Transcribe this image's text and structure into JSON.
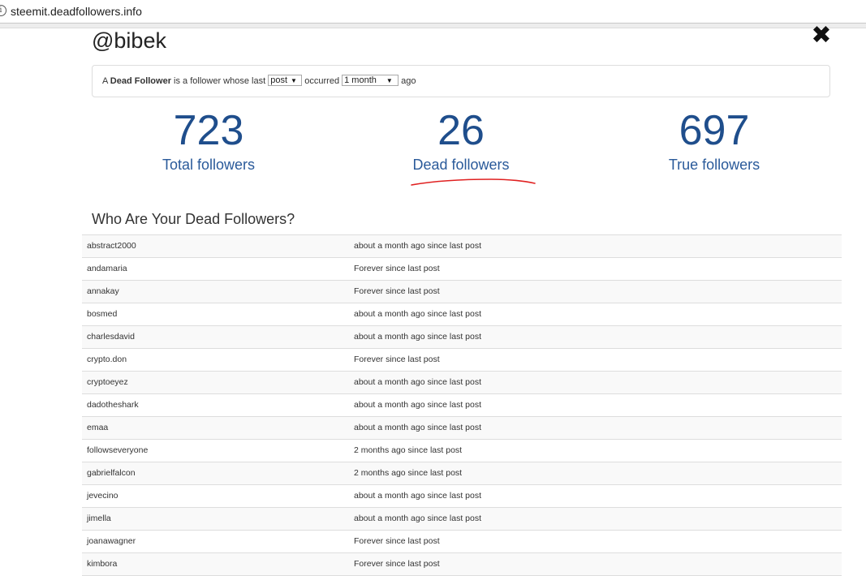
{
  "browser": {
    "url": "steemit.deadfollowers.info",
    "info_icon": "info-icon"
  },
  "modal": {
    "handle": "@bibek",
    "close_icon": "close-x-icon",
    "close_glyph": "✖"
  },
  "definition": {
    "prefix": "A ",
    "term": "Dead Follower",
    "middle1": " is a follower whose last ",
    "activity_select": "post",
    "middle2": " occurred ",
    "period_select": "1 month",
    "suffix": " ago"
  },
  "stats": {
    "total": {
      "value": "723",
      "label": "Total followers"
    },
    "dead": {
      "value": "26",
      "label": "Dead followers"
    },
    "true": {
      "value": "697",
      "label": "True followers"
    }
  },
  "list": {
    "heading": "Who Are Your Dead Followers?",
    "rows": [
      {
        "name": "abstract2000",
        "status": "about a month ago since last post"
      },
      {
        "name": "andamaria",
        "status": "Forever since last post"
      },
      {
        "name": "annakay",
        "status": "Forever since last post"
      },
      {
        "name": "bosmed",
        "status": "about a month ago since last post"
      },
      {
        "name": "charlesdavid",
        "status": "about a month ago since last post"
      },
      {
        "name": "crypto.don",
        "status": "Forever since last post"
      },
      {
        "name": "cryptoeyez",
        "status": "about a month ago since last post"
      },
      {
        "name": "dadotheshark",
        "status": "about a month ago since last post"
      },
      {
        "name": "emaa",
        "status": "about a month ago since last post"
      },
      {
        "name": "followseveryone",
        "status": "2 months ago since last post"
      },
      {
        "name": "gabrielfalcon",
        "status": "2 months ago since last post"
      },
      {
        "name": "jevecino",
        "status": "about a month ago since last post"
      },
      {
        "name": "jimella",
        "status": "about a month ago since last post"
      },
      {
        "name": "joanawagner",
        "status": "Forever since last post"
      },
      {
        "name": "kimbora",
        "status": "Forever since last post"
      }
    ]
  },
  "colors": {
    "stat_blue": "#1f4e8c",
    "annotation_red": "#e02020"
  }
}
